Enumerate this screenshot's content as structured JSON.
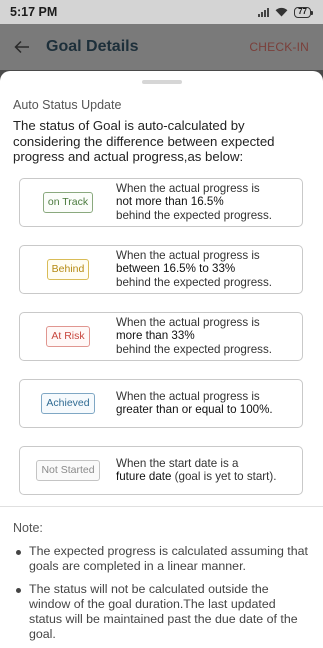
{
  "status_bar": {
    "time": "5:17 PM",
    "battery": "77"
  },
  "app_bar": {
    "title": "Goal Details",
    "action": "CHECK-IN"
  },
  "sheet": {
    "section_title": "Auto Status Update",
    "intro": "The status of Goal is auto-calculated by considering the difference between expected progress and actual progress,as below:",
    "statuses": [
      {
        "badge": "on Track",
        "color": "#4a7a3d",
        "line1": "When the actual progress is",
        "line2": "not more than 16.5%",
        "line3": "behind the expected progress."
      },
      {
        "badge": "Behind",
        "color": "#b58a12",
        "line1": "When the actual progress is",
        "line2": "between 16.5% to 33%",
        "line3": "behind the expected progress."
      },
      {
        "badge": "At Risk",
        "color": "#c8473e",
        "line1": "When the actual progress is",
        "line2": "more than 33%",
        "line3": "behind the expected progress."
      },
      {
        "badge": "Achieved",
        "color": "#2f6b93",
        "line1": "When the actual progress is",
        "line2": "greater than or equal to 100%.",
        "line3": ""
      },
      {
        "badge": "Not Started",
        "color": "#8a8a8a",
        "line1": "When the start date is a",
        "line2": "future date",
        "line3": " (goal is yet to start)."
      }
    ],
    "note_title": "Note:",
    "notes": [
      "The expected progress is calculated assuming that goals are completed in a linear manner.",
      "The status will not be calculated outside the window of the goal duration.The last updated status will be maintained past the due date of the goal."
    ]
  }
}
